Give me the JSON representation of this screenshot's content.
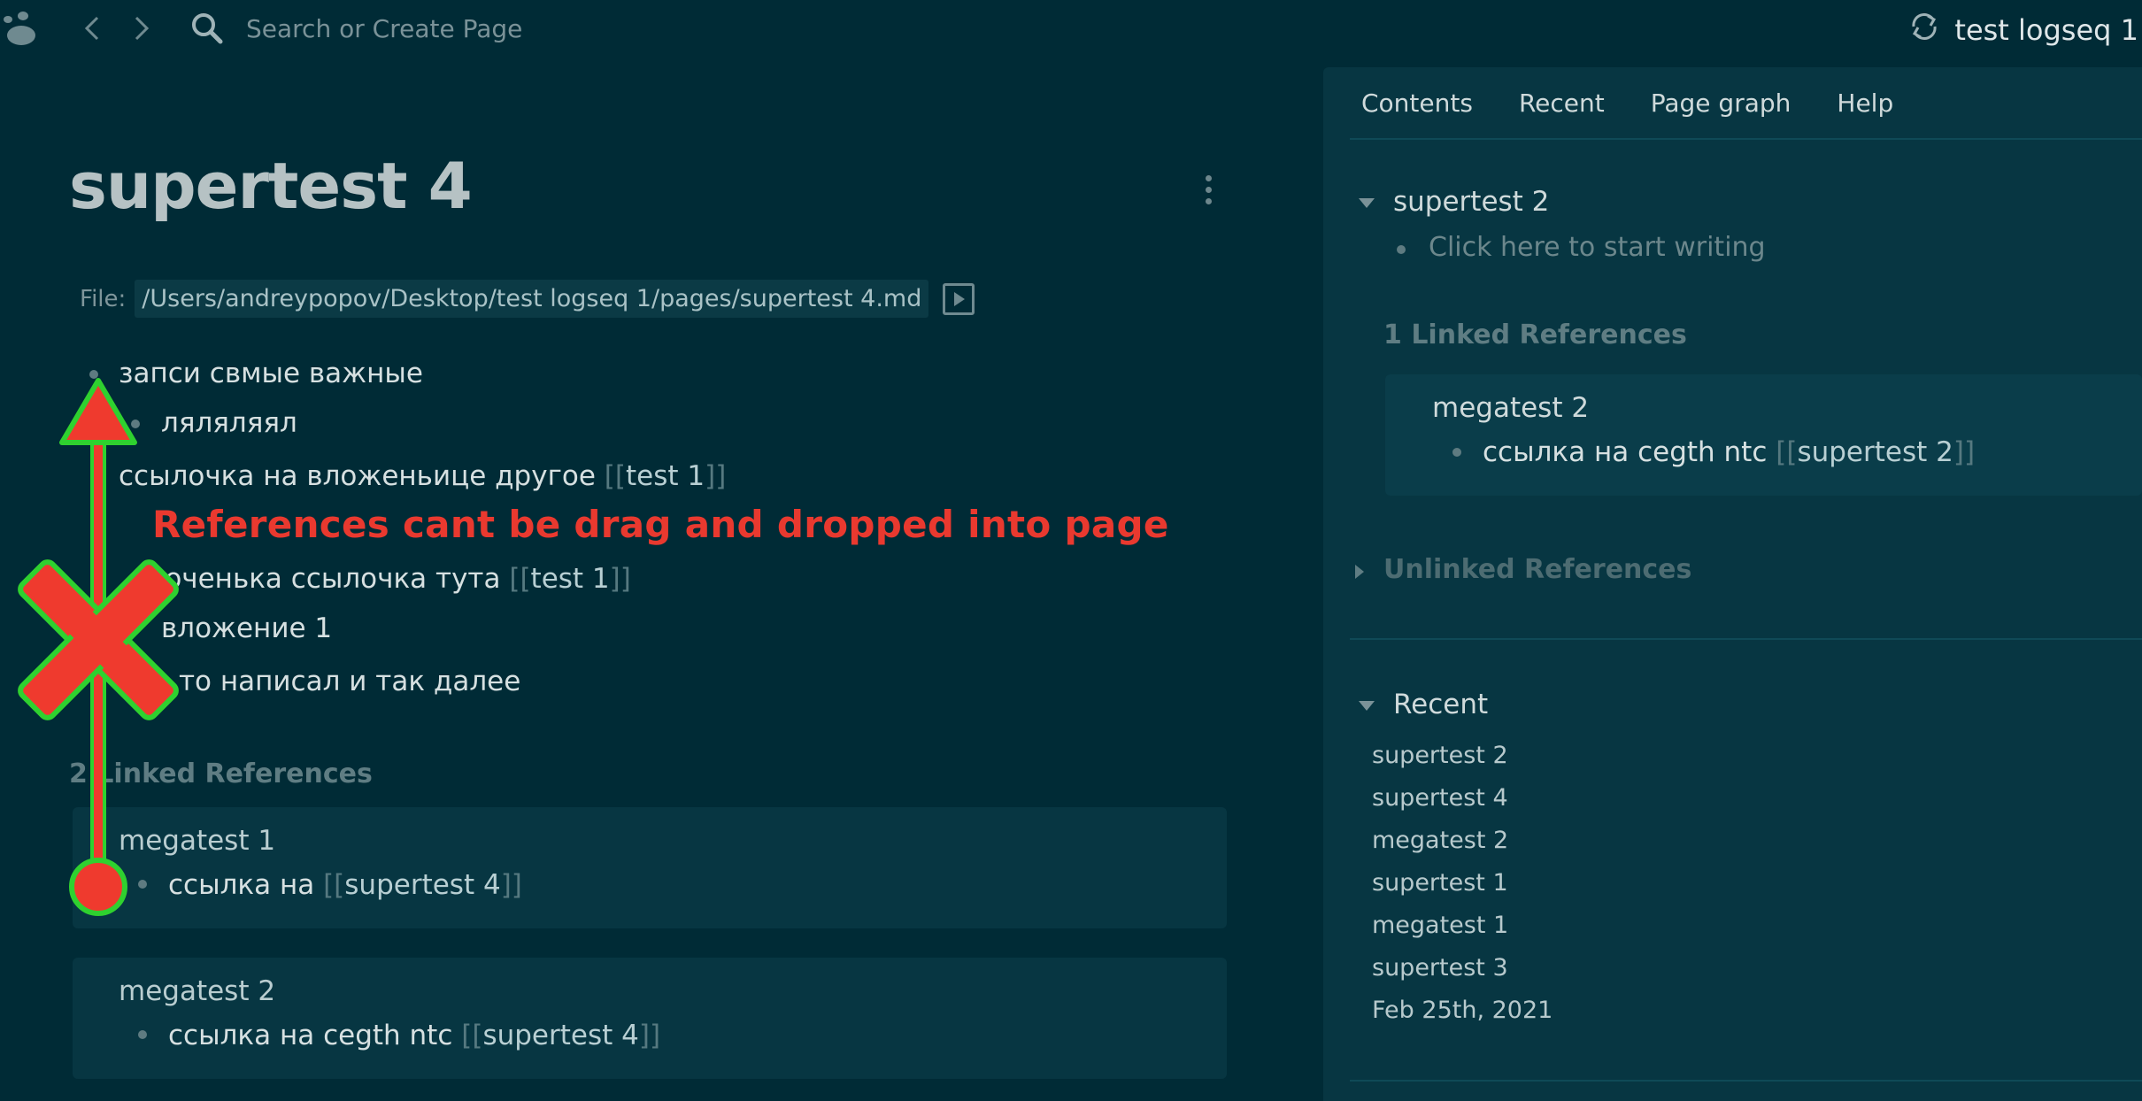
{
  "topbar": {
    "search_placeholder": "Search or Create Page",
    "graph_name": "test logseq 1",
    "icons": [
      "logo-icon",
      "back-icon",
      "forward-icon",
      "search-icon",
      "sync-icon"
    ]
  },
  "page": {
    "title": "supertest 4",
    "file_label": "File:",
    "file_path": "/Users/andreypopov/Desktop/test logseq 1/pages/supertest 4.md",
    "blocks": [
      {
        "text": "запси свмые важные"
      },
      {
        "text": "ляляляял"
      },
      {
        "text": "ссылочка на вложеньице другое ",
        "open": "[[",
        "ref": "test 1",
        "close": "]]"
      },
      {
        "text": "чоченька ссылочка тута ",
        "open": "[[",
        "ref": "test 1",
        "close": "]]"
      },
      {
        "text": "вложение 1"
      },
      {
        "text": "то написал и так далее"
      }
    ],
    "linked_refs_heading": "2 Linked References",
    "linked_refs": [
      {
        "page": "megatest 1",
        "text": "ссылка на ",
        "open": "[[",
        "ref": "supertest 4",
        "close": "]]"
      },
      {
        "page": "megatest 2",
        "text": "ссылка на cegth ntc ",
        "open": "[[",
        "ref": "supertest 4",
        "close": "]]"
      }
    ]
  },
  "annotation": {
    "text": "References cant be drag and dropped into page",
    "color": "#e9392f",
    "outline_color": "#2fd12f"
  },
  "sidebar": {
    "tabs": [
      "Contents",
      "Recent",
      "Page graph",
      "Help"
    ],
    "contents": {
      "title": "supertest 2",
      "placeholder": "Click here to start writing",
      "linked_heading": "1 Linked References",
      "linked": {
        "page": "megatest 2",
        "text": "ссылка на cegth ntc ",
        "open": "[[",
        "ref": "supertest 2",
        "close": "]]"
      },
      "unlinked_heading": "Unlinked References"
    },
    "recent": {
      "title": "Recent",
      "items": [
        "supertest 2",
        "supertest 4",
        "megatest 2",
        "supertest 1",
        "megatest 1",
        "supertest 3",
        "Feb 25th, 2021"
      ]
    }
  },
  "colors": {
    "background": "#002b36",
    "sidebar_bg": "#073642",
    "card_bg": "#073642",
    "bracket": "#567980"
  }
}
